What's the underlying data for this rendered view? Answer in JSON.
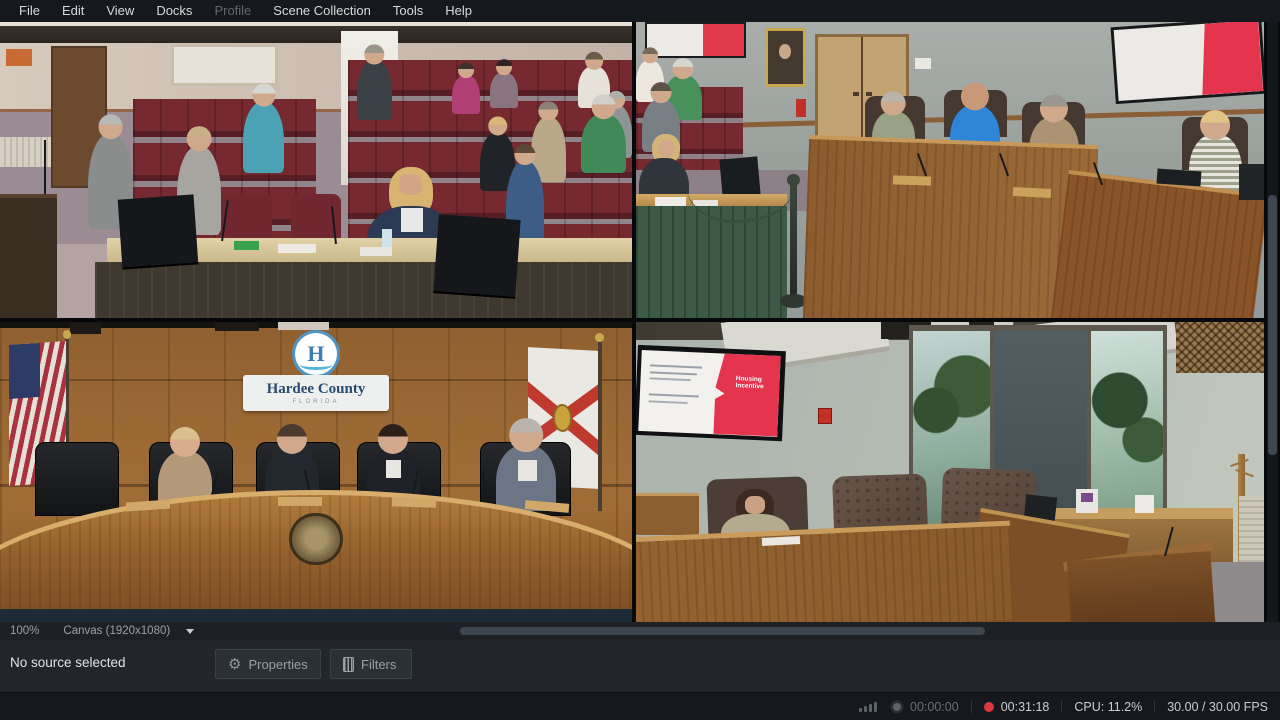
{
  "menu_bar": {
    "items": [
      {
        "label": "File",
        "enabled": true
      },
      {
        "label": "Edit",
        "enabled": true
      },
      {
        "label": "View",
        "enabled": true
      },
      {
        "label": "Docks",
        "enabled": true
      },
      {
        "label": "Profile",
        "enabled": false
      },
      {
        "label": "Scene Collection",
        "enabled": true
      },
      {
        "label": "Tools",
        "enabled": true
      },
      {
        "label": "Help",
        "enabled": true
      }
    ]
  },
  "preview": {
    "zoom_level": "100%",
    "canvas_label": "Canvas (1920x1080)",
    "feeds": [
      {
        "position": "top-left",
        "description": "Audience seating area with maroon chairs and staff desk with monitors"
      },
      {
        "position": "top-right",
        "description": "Commission box side view with officials, clerk table and wall screens showing a red and white slide"
      },
      {
        "position": "bottom-left",
        "description": "Main dais with four commissioners, county wall sign, US and Florida flags",
        "sign_title": "Hardee County",
        "sign_subtitle": "FLORIDA",
        "logo_letter": "H"
      },
      {
        "position": "bottom-right",
        "description": "Side view of dais with presentation TV, windows, coat rack and podium",
        "slide_title": "Housing Incentive"
      }
    ]
  },
  "source_toolbar": {
    "status_text": "No source selected",
    "buttons": [
      {
        "label": "Properties",
        "icon": "gear-icon"
      },
      {
        "label": "Filters",
        "icon": "filter-icon"
      }
    ]
  },
  "status_bar": {
    "stream_time": "00:00:00",
    "record_time": "00:31:18",
    "cpu_usage": "CPU: 11.2%",
    "fps": "30.00 / 30.00 FPS"
  },
  "colors": {
    "record_red": "#de383e",
    "slide_red": "#e5344e",
    "logo_blue": "#4f94c4",
    "chair_maroon": "#76292f",
    "wood_brown": "#9a6834",
    "panel_bg": "#22262a",
    "statusbar_bg": "#15181c"
  }
}
